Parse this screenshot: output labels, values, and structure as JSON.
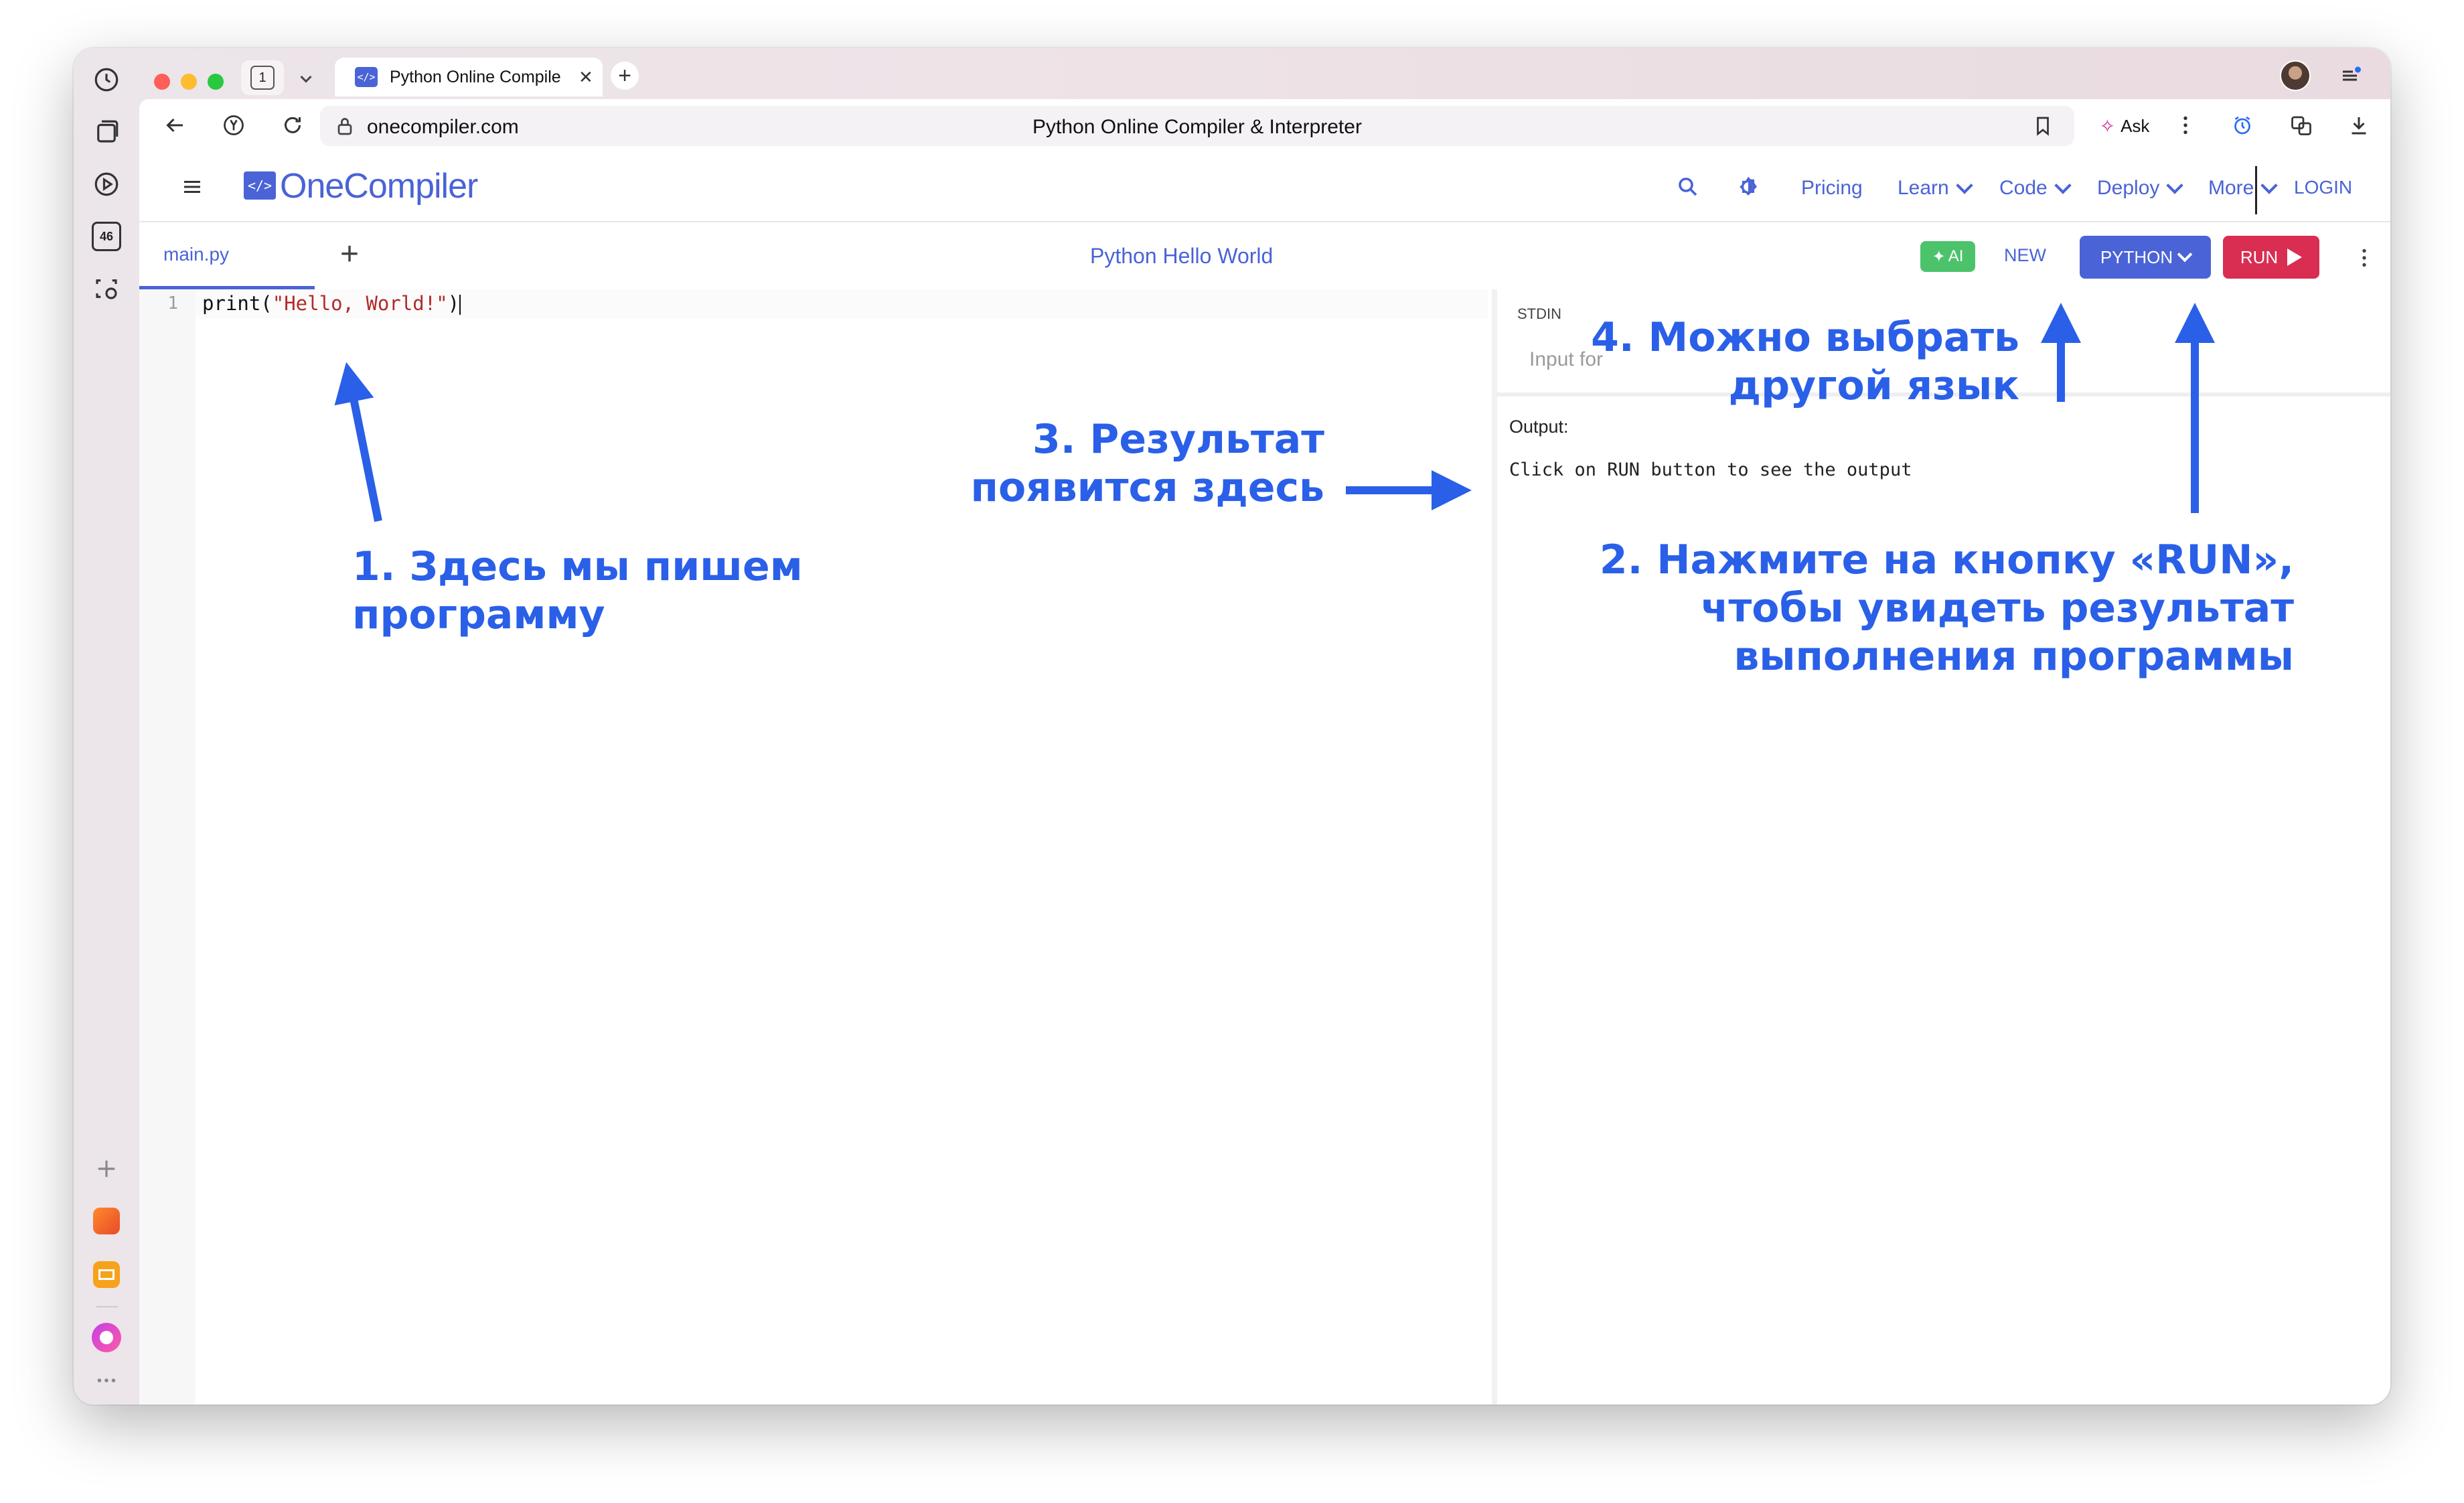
{
  "browser": {
    "tab_count": "1",
    "tab_title": "Python Online Compile",
    "url": "onecompiler.com",
    "page_title": "Python Online Compiler & Interpreter",
    "ask_label": "Ask",
    "sidebar_badge": "46"
  },
  "header": {
    "logo": "OneCompiler",
    "nav": {
      "pricing": "Pricing",
      "learn": "Learn",
      "code": "Code",
      "deploy": "Deploy",
      "more": "More",
      "login": "LOGIN"
    }
  },
  "toolbar": {
    "file_tab": "main.py",
    "add_tab": "+",
    "project_title": "Python Hello World",
    "ai_label": "AI",
    "new_label": "NEW",
    "language": "PYTHON",
    "run_label": "RUN"
  },
  "editor": {
    "line_number": "1",
    "code_prefix": "print(",
    "code_string": "\"Hello, World!\"",
    "code_suffix": ")"
  },
  "panel": {
    "stdin_label": "STDIN",
    "stdin_placeholder": "Input for",
    "output_label": "Output:",
    "output_text": "Click on RUN button to see the output"
  },
  "annotations": {
    "a1": [
      "1. Здесь мы пишем",
      "программу"
    ],
    "a2": [
      "2. Нажмите на кнопку «RUN»,",
      "чтобы увидеть результат",
      "выполнения программы"
    ],
    "a3": [
      "3. Результат",
      "появится здесь"
    ],
    "a4": [
      "4. Можно выбрать",
      "другой язык"
    ]
  },
  "colors": {
    "brand": "#4a63d6",
    "run": "#d92d52",
    "ai": "#4cc36b",
    "annotation": "#2a5fe8"
  }
}
